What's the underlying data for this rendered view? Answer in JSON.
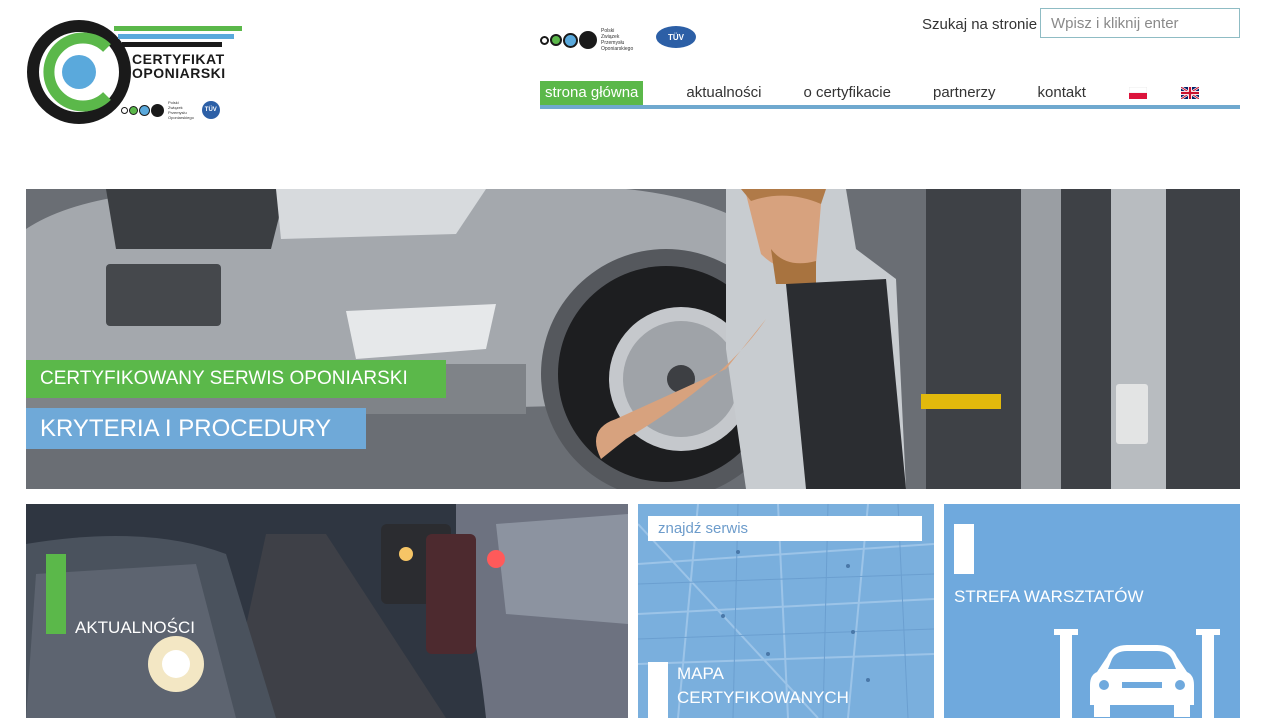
{
  "logo": {
    "title_line1": "CERTYFIKAT",
    "title_line2": "OPONIARSKI",
    "assoc_line1": "Polski",
    "assoc_line2": "Związek",
    "assoc_line3": "Przemysłu",
    "assoc_line4": "Oponiarskiego",
    "tuv": "TÜV"
  },
  "partners": {
    "assoc_line1": "Polski",
    "assoc_line2": "Związek",
    "assoc_line3": "Przemysłu",
    "assoc_line4": "Oponiarskiego",
    "tuv": "TÜV"
  },
  "search": {
    "label": "Szukaj na stronie",
    "placeholder": "Wpisz i kliknij enter"
  },
  "nav": {
    "items": [
      {
        "label": "strona główna",
        "active": true
      },
      {
        "label": "aktualności",
        "active": false
      },
      {
        "label": "o certyfikacie",
        "active": false
      },
      {
        "label": "partnerzy",
        "active": false
      },
      {
        "label": "kontakt",
        "active": false
      }
    ],
    "flags": [
      "pl-flag-icon",
      "uk-flag-icon"
    ]
  },
  "hero": {
    "green_label": "CERTYFIKOWANY SERWIS OPONIARSKI",
    "blue_label": "KRYTERIA I PROCEDURY"
  },
  "tiles": {
    "news_label": "AKTUALNOŚCI",
    "map_search_placeholder": "znajdź serwis",
    "map_title_line1": "MAPA",
    "map_title_line2": "CERTYFIKOWANYCH",
    "workshop_label": "STREFA WARSZTATÓW"
  },
  "colors": {
    "green": "#5bb84a",
    "blue": "#6fa9d8",
    "nav_underline": "#6fa9cf"
  }
}
